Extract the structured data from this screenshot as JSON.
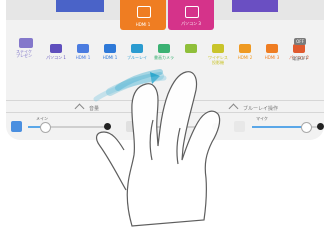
{
  "colors": {
    "accent_orange": "#ef7d22",
    "accent_pink": "#d5338a",
    "accent_purple": "#5f4fbd",
    "accent_blue": "#5aa7e8",
    "source_hdmi": "#2e79d8",
    "source_pc": "#4b7ce0",
    "source_green": "#3bb173",
    "source_wireless": "#c9c42a",
    "source_orange": "#ef7d22",
    "power_grey": "#7b7b7b"
  },
  "top_sources": [
    {
      "label": "HDMI 1",
      "color": "#ef7d22"
    },
    {
      "label": "パソコン 3",
      "color": "#d5338a"
    }
  ],
  "mini_card": {
    "label": "ステイク\nプレゼン"
  },
  "sources": [
    {
      "label": "パソコン 1",
      "color": "#5f4fbd"
    },
    {
      "label": "HDMI 1",
      "color": "#4b7ce0"
    },
    {
      "label": "HDMI 1",
      "color": "#2e79d8"
    },
    {
      "label": "ブルーレイ",
      "color": "#2b9bd0"
    },
    {
      "label": "書画カメラ",
      "color": "#3bb173"
    },
    {
      "label": "",
      "color": "#8fbf3a"
    },
    {
      "label": "ワイヤレス\n投影機",
      "color": "#c9c42a"
    },
    {
      "label": "HDMI 2",
      "color": "#ef9a22"
    },
    {
      "label": "HDMI 3",
      "color": "#ef7d22"
    },
    {
      "label": "パソコン 2",
      "color": "#e05a2e"
    }
  ],
  "power": {
    "badge": "OFF",
    "label": "電源OFF"
  },
  "collapse": {
    "left": "音量",
    "right": "ブルーレイ操作"
  },
  "mixer": {
    "main_label": "メイン",
    "mic_label": "マイク",
    "main_level": 0.2,
    "mic_level": 0.8
  }
}
